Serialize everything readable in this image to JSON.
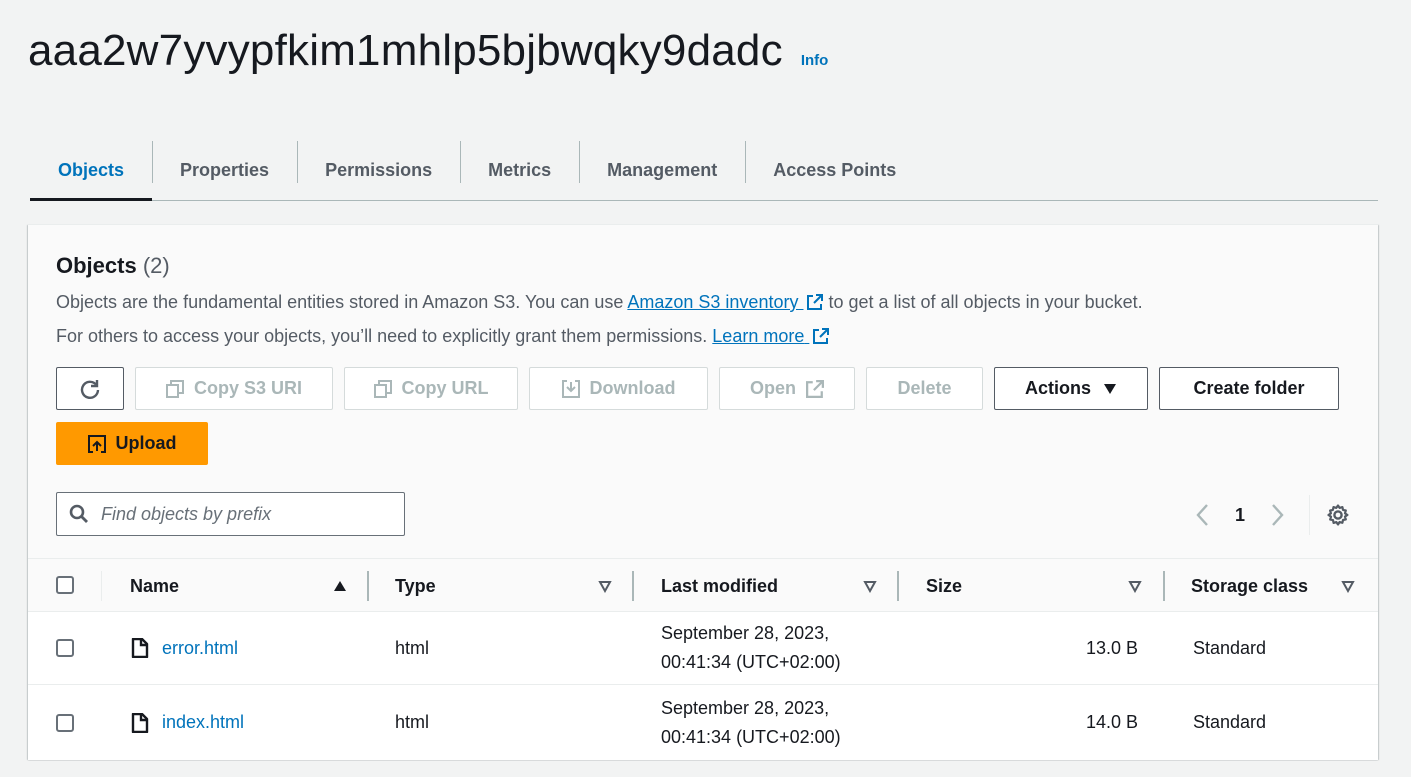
{
  "header": {
    "bucket_name": "aaa2w7yvypfkim1mhlp5bjbwqky9dadc",
    "info_label": "Info"
  },
  "tabs": [
    {
      "label": "Objects",
      "active": true
    },
    {
      "label": "Properties",
      "active": false
    },
    {
      "label": "Permissions",
      "active": false
    },
    {
      "label": "Metrics",
      "active": false
    },
    {
      "label": "Management",
      "active": false
    },
    {
      "label": "Access Points",
      "active": false
    }
  ],
  "objects_panel": {
    "title": "Objects",
    "count": "(2)",
    "description_line1_prefix": "Objects are the fundamental entities stored in Amazon S3. You can use ",
    "inventory_link": "Amazon S3 inventory",
    "description_line1_suffix": " to get a list of all objects in your bucket.",
    "description_line2_prefix": "For others to access your objects, you’ll need to explicitly grant them permissions. ",
    "learn_more_link": "Learn more"
  },
  "toolbar": {
    "refresh_icon": "refresh-icon",
    "copy_s3_uri": "Copy S3 URI",
    "copy_url": "Copy URL",
    "download": "Download",
    "open": "Open",
    "delete": "Delete",
    "actions": "Actions",
    "create_folder": "Create folder",
    "upload": "Upload"
  },
  "search": {
    "placeholder": "Find objects by prefix",
    "value": ""
  },
  "pagination": {
    "current_page": "1"
  },
  "table": {
    "columns": [
      "Name",
      "Type",
      "Last modified",
      "Size",
      "Storage class"
    ],
    "rows": [
      {
        "name": "error.html",
        "type": "html",
        "date_line1": "September 28, 2023,",
        "date_line2": "00:41:34 (UTC+02:00)",
        "size": "13.0 B",
        "storage_class": "Standard"
      },
      {
        "name": "index.html",
        "type": "html",
        "date_line1": "September 28, 2023,",
        "date_line2": "00:41:34 (UTC+02:00)",
        "size": "14.0 B",
        "storage_class": "Standard"
      }
    ]
  },
  "colors": {
    "link": "#0073bb",
    "primary_button": "#ff9900",
    "page_background": "#f2f3f3"
  }
}
